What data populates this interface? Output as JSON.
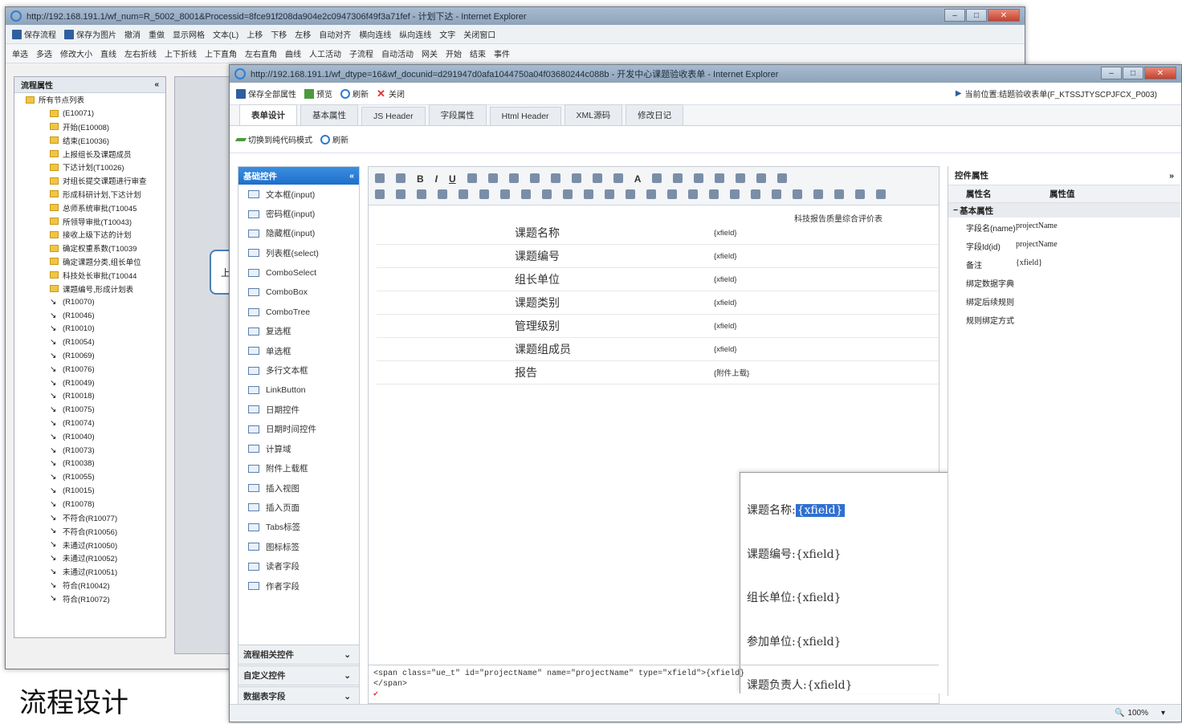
{
  "back_window": {
    "title": "http://192.168.191.1/wf_num=R_5002_8001&Processid=8fce91f208da904e2c0947306f49f3a71fef - 计划下达 - Internet Explorer",
    "toolbar1": [
      "保存流程",
      "保存为图片",
      "撤消",
      "重做",
      "显示网格",
      "文本(L)",
      "上移",
      "下移",
      "左移",
      "自动对齐",
      "横向连线",
      "纵向连线",
      "文字",
      "关闭窗口"
    ],
    "toolbar2": [
      "单选",
      "多选",
      "修改大小",
      "直线",
      "左右折线",
      "上下折线",
      "上下直角",
      "左右直角",
      "曲线",
      "人工活动",
      "子流程",
      "自动活动",
      "网关",
      "开始",
      "结束",
      "事件"
    ],
    "tree_header": "流程属性",
    "tree_collapse": "«",
    "tree_root": "所有节点列表",
    "tree_items": [
      {
        "kind": "folder",
        "text": "(E10071)"
      },
      {
        "kind": "folder",
        "text": "开始(E10008)"
      },
      {
        "kind": "folder",
        "text": "结束(E10036)"
      },
      {
        "kind": "folder",
        "text": "上报组长及课题成员"
      },
      {
        "kind": "folder",
        "text": "下达计划(T10026)"
      },
      {
        "kind": "folder",
        "text": "对组长提交课题进行审查"
      },
      {
        "kind": "folder",
        "text": "形成科研计划,下达计划"
      },
      {
        "kind": "folder",
        "text": "总师系统审批(T10045"
      },
      {
        "kind": "folder",
        "text": "所领导审批(T10043)"
      },
      {
        "kind": "folder",
        "text": "接收上级下达的计划"
      },
      {
        "kind": "folder",
        "text": "确定权重系数(T10039"
      },
      {
        "kind": "folder",
        "text": "确定课题分类,组长单位"
      },
      {
        "kind": "folder",
        "text": "科技处长审批(T10044"
      },
      {
        "kind": "folder",
        "text": "课题编号,形成计划表"
      },
      {
        "kind": "arrow",
        "text": "(R10070)"
      },
      {
        "kind": "arrow",
        "text": "(R10046)"
      },
      {
        "kind": "arrow",
        "text": "(R10010)"
      },
      {
        "kind": "arrow",
        "text": "(R10054)"
      },
      {
        "kind": "arrow",
        "text": "(R10069)"
      },
      {
        "kind": "arrow",
        "text": "(R10076)"
      },
      {
        "kind": "arrow",
        "text": "(R10049)"
      },
      {
        "kind": "arrow",
        "text": "(R10018)"
      },
      {
        "kind": "arrow",
        "text": "(R10075)"
      },
      {
        "kind": "arrow",
        "text": "(R10074)"
      },
      {
        "kind": "arrow",
        "text": "(R10040)"
      },
      {
        "kind": "arrow",
        "text": "(R10073)"
      },
      {
        "kind": "arrow",
        "text": "(R10038)"
      },
      {
        "kind": "arrow",
        "text": "(R10055)"
      },
      {
        "kind": "arrow",
        "text": "(R10015)"
      },
      {
        "kind": "arrow",
        "text": "(R10078)"
      },
      {
        "kind": "arrow",
        "text": "不符合(R10077)"
      },
      {
        "kind": "arrow",
        "text": "不符合(R10056)"
      },
      {
        "kind": "arrow",
        "text": "未通过(R10050)"
      },
      {
        "kind": "arrow",
        "text": "未通过(R10052)"
      },
      {
        "kind": "arrow",
        "text": "未通过(R10051)"
      },
      {
        "kind": "arrow",
        "text": "符合(R10042)"
      },
      {
        "kind": "arrow",
        "text": "符合(R10072)"
      }
    ],
    "canvas_glyph": "上"
  },
  "bottom_label": "流程设计",
  "front_window": {
    "title": "http://192.168.191.1/wf_dtype=16&wf_docunid=d291947d0afa1044750a04f03680244c088b - 开发中心课题验收表单 - Internet Explorer",
    "actions": [
      "保存全部属性",
      "预览",
      "刷新",
      "关闭"
    ],
    "breadcrumb": "当前位置:结题验收表单(F_KTSSJTYSCPJFCX_P003)",
    "tabs": [
      "表单设计",
      "基本属性",
      "JS Header",
      "字段属性",
      "Html Header",
      "XML源码",
      "修改日记"
    ],
    "mode_switch": "切换到纯代码模式",
    "mode_refresh": "刷新",
    "controls_header": "基础控件",
    "controls": [
      "文本框(input)",
      "密码框(input)",
      "隐藏框(input)",
      "列表框(select)",
      "ComboSelect",
      "ComboBox",
      "ComboTree",
      "复选框",
      "单选框",
      "多行文本框",
      "LinkButton",
      "日期控件",
      "日期时间控件",
      "计算域",
      "附件上载框",
      "插入视图",
      "插入页面",
      "Tabs标签",
      "图标标签",
      "读者字段",
      "作者字段"
    ],
    "accordion": [
      "流程相关控件",
      "自定义控件",
      "数据表字段"
    ],
    "form_title": "科技报告质量综合评价表",
    "form_rows": [
      {
        "label": "课题名称",
        "value": "{xfield}"
      },
      {
        "label": "课题编号",
        "value": "{xfield}"
      },
      {
        "label": "组长单位",
        "value": "{xfield}"
      },
      {
        "label": "课题类别",
        "value": "{xfield}"
      },
      {
        "label": "管理级别",
        "value": "{xfield}"
      },
      {
        "label": "课题组成员",
        "value": "{xfield}"
      },
      {
        "label": "报告",
        "value": "{附件上载}"
      }
    ],
    "popup_rows": [
      {
        "label": "课题名称:",
        "value": "{xfield}",
        "selected": true
      },
      {
        "label": "课题编号:",
        "value": "{xfield}"
      },
      {
        "label": "组长单位:",
        "value": "{xfield}"
      },
      {
        "label": "参加单位:",
        "value": "{xfield}"
      },
      {
        "label": "课题负责人:",
        "value": "{xfield}"
      }
    ],
    "source_line1": "<span class=\"ue_t\" id=\"projectName\" name=\"projectName\" type=\"xfield\">{xfield}",
    "source_line2": "</span>",
    "source_check": "✔",
    "props_header": "控件属性",
    "props_expand": "»",
    "props_col_name": "属性名",
    "props_col_value": "属性值",
    "props_section": "基本属性",
    "props": [
      {
        "k": "字段名(name)",
        "v": "projectName"
      },
      {
        "k": "字段Id(id)",
        "v": "projectName"
      },
      {
        "k": "备注",
        "v": "{xfield}"
      },
      {
        "k": "绑定数据字典",
        "v": ""
      },
      {
        "k": "绑定后续规则",
        "v": ""
      },
      {
        "k": "规则绑定方式",
        "v": ""
      }
    ],
    "zoom": "100%"
  },
  "colors": {
    "accent": "#1e6fcc",
    "selection": "#2f6fd1",
    "title_bar": "#9aaec4"
  }
}
